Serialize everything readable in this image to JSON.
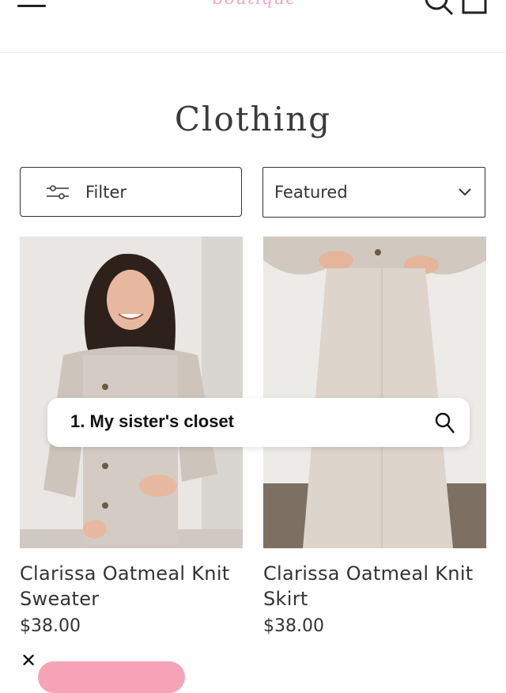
{
  "header": {
    "logo_text": "boutique",
    "icons": [
      "hamburger-menu-icon",
      "search-icon",
      "cart-icon"
    ]
  },
  "page": {
    "title": "Clothing"
  },
  "toolbar": {
    "filter_label": "Filter",
    "sort_selected": "Featured"
  },
  "products": [
    {
      "name": "Clarissa Oatmeal Knit Sweater",
      "price": "$38.00"
    },
    {
      "name": "Clarissa Oatmeal Knit Skirt",
      "price": "$38.00"
    }
  ],
  "search_overlay": {
    "query": "1. My sister's closet"
  },
  "colors": {
    "accent_pink": "#f6a3b8",
    "logo_pink": "#f0a8c2",
    "text": "#333333"
  }
}
